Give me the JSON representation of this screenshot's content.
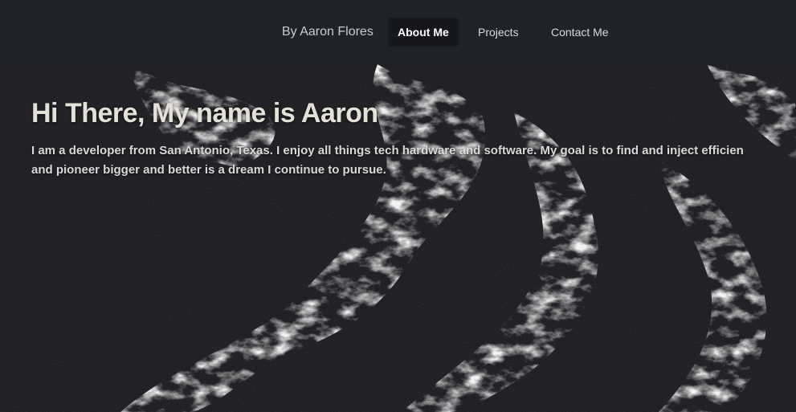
{
  "nav": {
    "brand": "By Aaron Flores",
    "items": [
      {
        "label": "About Me",
        "active": true
      },
      {
        "label": "Projects",
        "active": false
      },
      {
        "label": "Contact Me",
        "active": false
      }
    ]
  },
  "hero": {
    "title": "Hi There, My name is Aaron",
    "text_line1": "I am a developer from San Antonio, Texas. I enjoy all things tech hardware and software. My goal is to find and inject efficien",
    "text_line2": "and pioneer bigger and better is a dream I continue to pursue."
  },
  "colors": {
    "navbar_bg": "#1f222a",
    "active_tab_bg": "#15171c",
    "hero_bg": "#101113"
  }
}
